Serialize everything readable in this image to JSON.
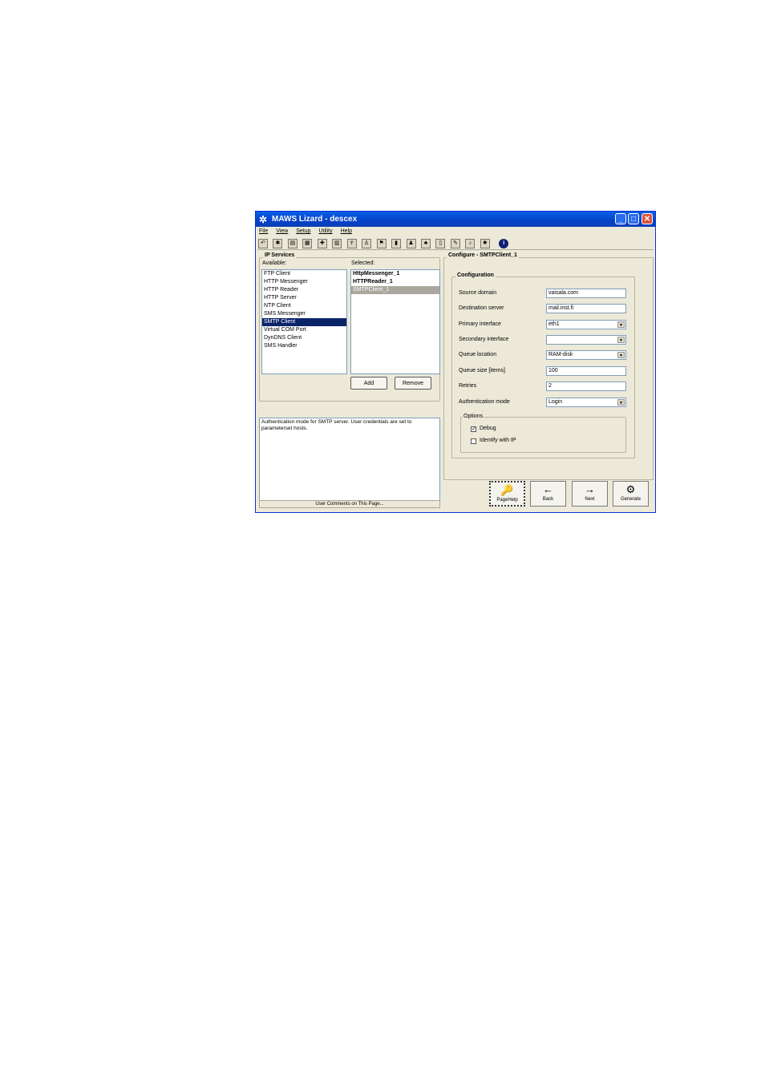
{
  "window": {
    "title": "MAWS Lizard - descex"
  },
  "menu": [
    "File",
    "View",
    "Setup",
    "Utility",
    "Help"
  ],
  "toolbar": {
    "icons": [
      "open-icon",
      "bug-icon",
      "dec-icon",
      "dec2-icon",
      "plus-icon",
      "grid-icon",
      "figure-icon",
      "figure2-icon",
      "flag-icon",
      "bars-icon",
      "people-icon",
      "tree-icon",
      "page-icon",
      "pen-icon",
      "bell-icon",
      "gear-icon"
    ],
    "info_glyph": "i"
  },
  "ip_services": {
    "title": "IP Services",
    "available_label": "Available:",
    "selected_label": "Selected:",
    "available": [
      "FTP Client",
      "HTTP Messenger",
      "HTTP Reader",
      "HTTP Server",
      "NTP Client",
      "SMS Messenger",
      "SMTP Client",
      "Virtual COM Port",
      "DynDNS Client",
      "SMS Handler"
    ],
    "available_selected": "SMTP Client",
    "selected": [
      "HttpMessenger_1",
      "HTTPReader_1",
      "SMTPClient_1"
    ],
    "selected_selected": "SMTPClient_1",
    "add_label": "Add",
    "remove_label": "Remove"
  },
  "help_text": "Authentication mode for SMTP server. User credentials are set to parameterset hosts.",
  "user_comments_label": "User Comments on This Page...",
  "configure": {
    "title": "Configure - SMTPClient_1",
    "group_title": "Configuration",
    "fields": [
      {
        "label": "Source domain",
        "value": "vaisala.com",
        "type": "text"
      },
      {
        "label": "Destination server",
        "value": "mail.inst.fi",
        "type": "text"
      },
      {
        "label": "Primary interface",
        "value": "eth1",
        "type": "select"
      },
      {
        "label": "Secondary interface",
        "value": "",
        "type": "select"
      },
      {
        "label": "Queue location",
        "value": "RAM-disk",
        "type": "select"
      },
      {
        "label": "Queue size [items]",
        "value": "100",
        "type": "text"
      },
      {
        "label": "Retries",
        "value": "2",
        "type": "text"
      },
      {
        "label": "Authentication mode",
        "value": "Login",
        "type": "select"
      }
    ],
    "options_title": "Options",
    "options": [
      {
        "label": "Debug",
        "checked": true,
        "mark": "✓"
      },
      {
        "label": "Identify with IP",
        "checked": false,
        "mark": ""
      }
    ]
  },
  "nav": {
    "pagehelp": {
      "label": "PageHelp",
      "glyph": "🔑"
    },
    "back": {
      "label": "Back",
      "glyph": "←"
    },
    "next": {
      "label": "Next",
      "glyph": "→"
    },
    "generate": {
      "label": "Generate",
      "glyph": "⚙"
    }
  }
}
